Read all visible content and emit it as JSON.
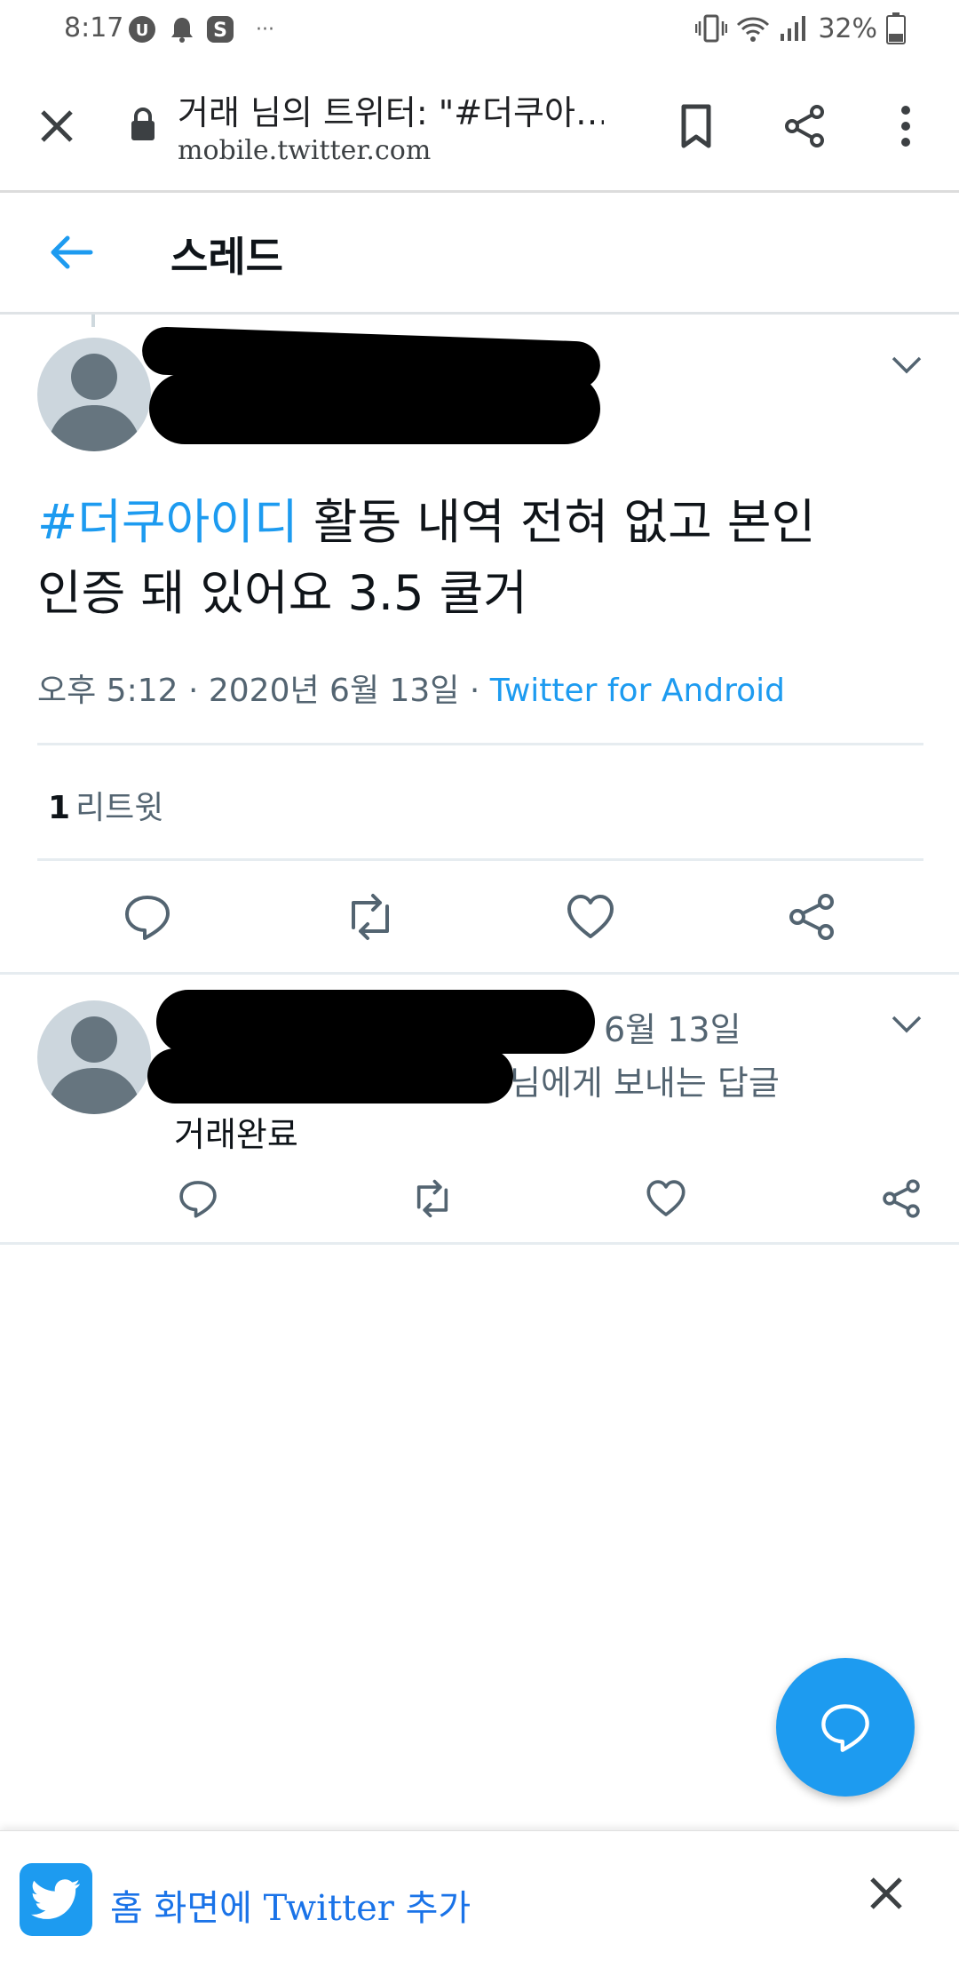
{
  "status_bar": {
    "time": "8:17",
    "battery": "32%",
    "overflow": "···"
  },
  "browser": {
    "page_title": "거래 님의 트위터: \"#더쿠아…",
    "url": "mobile.twitter.com"
  },
  "header": {
    "title": "스레드"
  },
  "tweet": {
    "hashtag": "#더쿠아이디",
    "text_line1": " 활동 내역 전혀 없고 본인",
    "text_line2": "인증 돼 있어요 3.5 쿨거",
    "timestamp": "오후 5:12 · 2020년 6월 13일",
    "separator": " · ",
    "source": "Twitter for Android",
    "retweet_count": "1",
    "retweet_label": "리트윗"
  },
  "reply": {
    "date": "6월 13일",
    "context": "님에게 보내는 답글",
    "text": "거래완료"
  },
  "banner": {
    "text": "홈 화면에 Twitter 추가"
  },
  "colors": {
    "accent": "#1d9bf0",
    "secondary_text": "#536471",
    "divider": "#e6ecf0"
  },
  "icons": [
    "close-icon",
    "lock-icon",
    "bookmark-icon",
    "share-icon",
    "more-vert-icon",
    "back-arrow-icon",
    "chevron-down-icon",
    "reply-icon",
    "retweet-icon",
    "like-icon",
    "share-icon",
    "compose-icon",
    "twitter-bird-icon"
  ]
}
